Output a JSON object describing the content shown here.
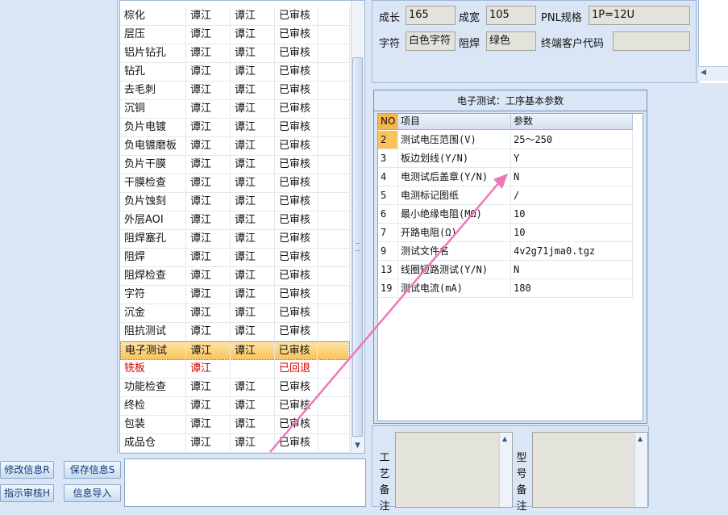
{
  "process_list": {
    "rows": [
      {
        "name": "棕化",
        "maker": "谭江",
        "reviewer": "谭江",
        "status": "已审核"
      },
      {
        "name": "层压",
        "maker": "谭江",
        "reviewer": "谭江",
        "status": "已审核"
      },
      {
        "name": "铝片钻孔",
        "maker": "谭江",
        "reviewer": "谭江",
        "status": "已审核"
      },
      {
        "name": "钻孔",
        "maker": "谭江",
        "reviewer": "谭江",
        "status": "已审核"
      },
      {
        "name": "去毛刺",
        "maker": "谭江",
        "reviewer": "谭江",
        "status": "已审核"
      },
      {
        "name": "沉铜",
        "maker": "谭江",
        "reviewer": "谭江",
        "status": "已审核"
      },
      {
        "name": "负片电镀",
        "maker": "谭江",
        "reviewer": "谭江",
        "status": "已审核"
      },
      {
        "name": "负电镀磨板",
        "maker": "谭江",
        "reviewer": "谭江",
        "status": "已审核"
      },
      {
        "name": "负片干膜",
        "maker": "谭江",
        "reviewer": "谭江",
        "status": "已审核"
      },
      {
        "name": "干膜检查",
        "maker": "谭江",
        "reviewer": "谭江",
        "status": "已审核"
      },
      {
        "name": "负片蚀刻",
        "maker": "谭江",
        "reviewer": "谭江",
        "status": "已审核"
      },
      {
        "name": "外层AOI",
        "maker": "谭江",
        "reviewer": "谭江",
        "status": "已审核"
      },
      {
        "name": "阻焊塞孔",
        "maker": "谭江",
        "reviewer": "谭江",
        "status": "已审核"
      },
      {
        "name": "阻焊",
        "maker": "谭江",
        "reviewer": "谭江",
        "status": "已审核"
      },
      {
        "name": "阻焊检查",
        "maker": "谭江",
        "reviewer": "谭江",
        "status": "已审核"
      },
      {
        "name": "字符",
        "maker": "谭江",
        "reviewer": "谭江",
        "status": "已审核"
      },
      {
        "name": "沉金",
        "maker": "谭江",
        "reviewer": "谭江",
        "status": "已审核"
      },
      {
        "name": "阻抗测试",
        "maker": "谭江",
        "reviewer": "谭江",
        "status": "已审核"
      },
      {
        "name": "电子测试",
        "maker": "谭江",
        "reviewer": "谭江",
        "status": "已审核",
        "selected": true
      },
      {
        "name": "铣板",
        "maker": "谭江",
        "reviewer": "",
        "status": "已回退",
        "returned": true
      },
      {
        "name": "功能检查",
        "maker": "谭江",
        "reviewer": "谭江",
        "status": "已审核"
      },
      {
        "name": "终检",
        "maker": "谭江",
        "reviewer": "谭江",
        "status": "已审核"
      },
      {
        "name": "包装",
        "maker": "谭江",
        "reviewer": "谭江",
        "status": "已审核"
      },
      {
        "name": "成品仓",
        "maker": "谭江",
        "reviewer": "谭江",
        "status": "已审核"
      }
    ]
  },
  "buttons": {
    "modify": "修改信息R",
    "save": "保存信息S",
    "review": "指示审核H",
    "import": "信息导入"
  },
  "info": {
    "length_label": "成长",
    "length_value": "165",
    "width_label": "成宽",
    "width_value": "105",
    "pnl_label": "PNL规格",
    "pnl_value": "1P=12U",
    "char_label": "字符",
    "char_value": "白色字符",
    "mask_label": "阻焊",
    "mask_value": "绿色",
    "customer_label": "终端客户代码",
    "customer_value": ""
  },
  "params": {
    "title": "电子测试：工序基本参数",
    "headers": [
      "NO",
      "项目",
      "参数"
    ],
    "rows": [
      {
        "no": "2",
        "item": "测试电压范围(V)",
        "value": "25～250",
        "selected": true
      },
      {
        "no": "3",
        "item": "板边划线(Y/N)",
        "value": "Y"
      },
      {
        "no": "4",
        "item": "电测试后盖章(Y/N)",
        "value": "N"
      },
      {
        "no": "5",
        "item": "电测标记图纸",
        "value": "/"
      },
      {
        "no": "6",
        "item": "最小绝缘电阻(MΩ)",
        "value": "10"
      },
      {
        "no": "7",
        "item": "开路电阻(Ω)",
        "value": "10"
      },
      {
        "no": "9",
        "item": "测试文件名",
        "value": "4v2g71jma0.tgz"
      },
      {
        "no": "13",
        "item": "线圈短路测试(Y/N)",
        "value": "N"
      },
      {
        "no": "19",
        "item": "测试电流(mA)",
        "value": "180"
      }
    ]
  },
  "remarks": {
    "process_label": [
      "工",
      "艺",
      "备",
      "注"
    ],
    "model_label": [
      "型",
      "号",
      "备",
      "注"
    ]
  },
  "colors": {
    "annotation_arrow": "#ee77bb",
    "selected_row": "#f9c35c",
    "returned_text": "#d60000"
  }
}
